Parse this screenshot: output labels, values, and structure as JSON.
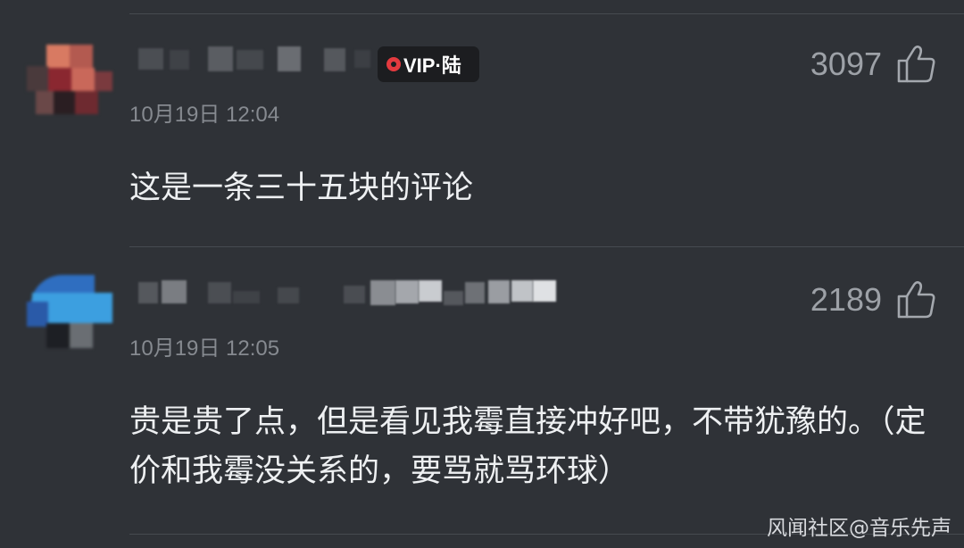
{
  "comments": [
    {
      "vip_badge": "VIP·陆",
      "timestamp": "10月19日 12:04",
      "like_count": "3097",
      "text": "这是一条三十五块的评论"
    },
    {
      "timestamp": "10月19日 12:05",
      "like_count": "2189",
      "text": "贵是贵了点，但是看见我霉直接冲好吧，不带犹豫的。（定价和我霉没关系的，要骂就骂环球）"
    }
  ],
  "watermark": "风闻社区@音乐先声",
  "icons": {
    "like": "thumbs-up-icon",
    "vip": "vip-badge-icon"
  },
  "colors": {
    "background": "#2f3237",
    "text_primary": "#eef0f2",
    "text_secondary": "#868a90",
    "vip_red": "#e43a3f"
  }
}
